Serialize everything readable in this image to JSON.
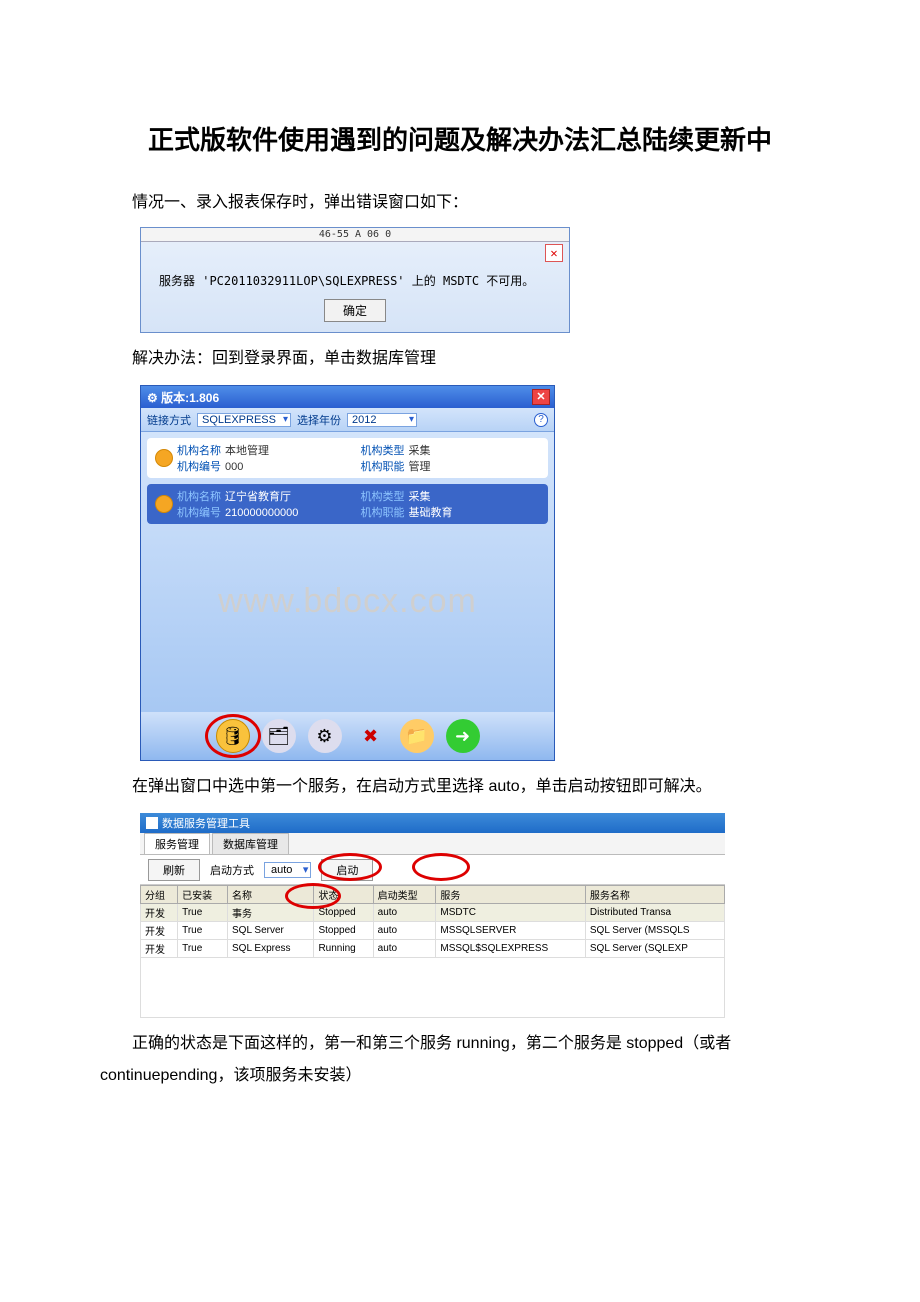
{
  "doc": {
    "title": "正式版软件使用遇到的问题及解决办法汇总陆续更新中",
    "p1": "情况一、录入报表保存时，弹出错误窗口如下：",
    "p2": "解决办法：回到登录界面，单击数据库管理",
    "p3": "在弹出窗口中选中第一个服务，在启动方式里选择 auto，单击启动按钮即可解决。",
    "p4": "正确的状态是下面这样的，第一和第三个服务 running，第二个服务是 stopped（或者 continuepending，该项服务未安装）"
  },
  "dialog1": {
    "header_bits": "46-55 A        06                     0",
    "message": "服务器 'PC2011032911LOP\\SQLEXPRESS' 上的 MSDTC 不可用。",
    "ok": "确定"
  },
  "login": {
    "title": "版本:1.806",
    "lbl_conn": "链接方式",
    "conn_value": "SQLEXPRESS",
    "lbl_year": "选择年份",
    "year_value": "2012",
    "row1": {
      "name_lbl": "机构名称",
      "name_val": "本地管理",
      "code_lbl": "机构编号",
      "code_val": "000",
      "type_lbl": "机构类型",
      "type_val": "采集",
      "role_lbl": "机构职能",
      "role_val": "管理"
    },
    "row2": {
      "name_lbl": "机构名称",
      "name_val": "辽宁省教育厅",
      "code_lbl": "机构编号",
      "code_val": "210000000000",
      "type_lbl": "机构类型",
      "type_val": "采集",
      "role_lbl": "机构职能",
      "role_val": "基础教育"
    },
    "watermark": "www.bdocx.com"
  },
  "svc": {
    "title": "数据服务管理工具",
    "tab1": "服务管理",
    "tab2": "数据库管理",
    "btn_refresh": "刷新",
    "lbl_startmode": "启动方式",
    "startmode_value": "auto",
    "btn_start": "启动",
    "cols": [
      "分组",
      "已安装",
      "名称",
      "状态",
      "启动类型",
      "服务",
      "服务名称"
    ],
    "rows": [
      [
        "开发",
        "True",
        "事务",
        "Stopped",
        "auto",
        "MSDTC",
        "Distributed Transa"
      ],
      [
        "开发",
        "True",
        "SQL Server",
        "Stopped",
        "auto",
        "MSSQLSERVER",
        "SQL Server (MSSQLS"
      ],
      [
        "开发",
        "True",
        "SQL Express",
        "Running",
        "auto",
        "MSSQL$SQLEXPRESS",
        "SQL Server (SQLEXP"
      ]
    ]
  }
}
